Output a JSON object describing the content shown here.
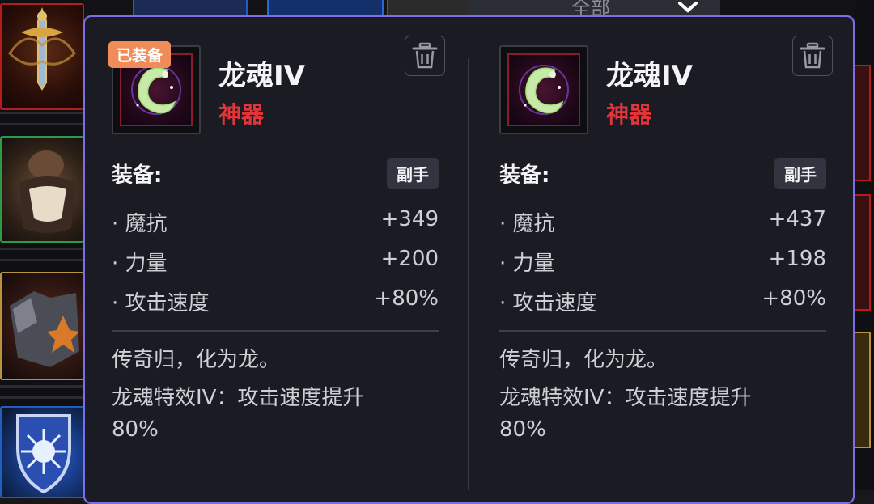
{
  "filter": {
    "label": "全部"
  },
  "colors": {
    "panel_border": "#7c6fe6",
    "rarity": "#e2353a",
    "badge": "#f08c5a"
  },
  "left_item": {
    "badge": "已装备",
    "name": "龙魂IV",
    "rarity": "神器",
    "slot_label": "装备:",
    "slot_value": "副手",
    "stats": [
      {
        "name": "· 魔抗",
        "value": "+349"
      },
      {
        "name": "· 力量",
        "value": "+200"
      },
      {
        "name": "· 攻击速度",
        "value": "+80%"
      }
    ],
    "description": [
      "传奇归，化为龙。",
      "龙魂特效IV：攻击速度提升",
      "80%"
    ],
    "icon": "dragon-soul-icon",
    "action_icon": "trash-icon"
  },
  "right_item": {
    "name": "龙魂IV",
    "rarity": "神器",
    "slot_label": "装备:",
    "slot_value": "副手",
    "stats": [
      {
        "name": "· 魔抗",
        "value": "+437"
      },
      {
        "name": "· 力量",
        "value": "+198"
      },
      {
        "name": "· 攻击速度",
        "value": "+80%"
      }
    ],
    "description": [
      "传奇归，化为龙。",
      "龙魂特效IV：攻击速度提升",
      "80%"
    ],
    "icon": "dragon-soul-icon",
    "action_icon": "trash-icon"
  }
}
